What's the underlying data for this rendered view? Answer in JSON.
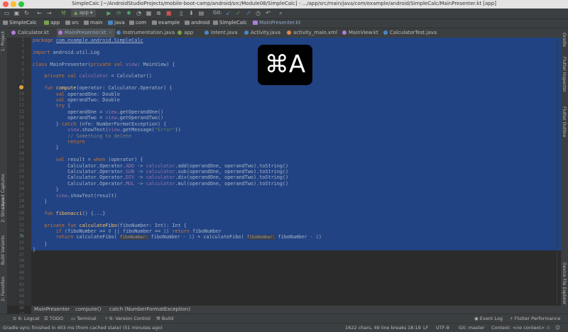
{
  "window": {
    "title": "SimpleCalc [~/AndroidStudioProjects/mobile-boot-camp/android/src/Module08/SimpleCalc] - .../app/src/main/java/com/example/android/SimpleCalc/MainPresenter.kt [app]"
  },
  "toolbar": {
    "run_config": "app",
    "git_label": "Git:"
  },
  "navbar": {
    "crumbs": [
      "SimpleCalc",
      "app",
      "src",
      "main",
      "java",
      "com",
      "example",
      "android",
      "SimpleCalc",
      "MainPresenter.kt"
    ]
  },
  "tabs": [
    {
      "label": "Calculator.kt",
      "active": false,
      "color": "#b07cd8"
    },
    {
      "label": "MainPresenter.kt",
      "active": true,
      "color": "#b07cd8"
    },
    {
      "label": "Instrumentation.java",
      "active": false,
      "color": "#4a86c8"
    },
    {
      "label": "app",
      "active": false,
      "color": "#7aa34a"
    },
    {
      "label": "Intent.java",
      "active": false,
      "color": "#4a86c8"
    },
    {
      "label": "Activity.java",
      "active": false,
      "color": "#4a86c8"
    },
    {
      "label": "activity_main.xml",
      "active": false,
      "color": "#e0884f"
    },
    {
      "label": "MainView.kt",
      "active": false,
      "color": "#b07cd8"
    },
    {
      "label": "CalculatorTest.java",
      "active": false,
      "color": "#4a86c8"
    }
  ],
  "left_tools": [
    "1: Project",
    "Layout Captures",
    "2: Structure",
    "Build Variants",
    "2: Favorites"
  ],
  "right_tools": [
    "Gradle",
    "Flutter Inspector",
    "Flutter Outline",
    "Device File Explorer"
  ],
  "gutter": {
    "line_numbers": [
      "1",
      "2",
      "3",
      "4",
      "5",
      "6",
      "7",
      "8",
      "9",
      "10",
      "11",
      "12",
      "13",
      "14",
      "15",
      "16",
      "17",
      "18",
      "19",
      "20",
      "21",
      "22",
      "23",
      "24",
      "25",
      "26",
      "27",
      "28",
      "29",
      "30",
      "31",
      "32",
      "33",
      "34",
      "35",
      "36",
      "37",
      "38",
      "39",
      "40",
      "41",
      "42",
      "43",
      "44",
      "45",
      "46",
      "47",
      "48",
      "49"
    ]
  },
  "code": {
    "package_kw": "package",
    "package_name": "com.example.android.SimpleCalc",
    "import_kw": "import",
    "import_name": "android.util.Log",
    "error_str": "\"Error\"",
    "comment": "// Something to delete",
    "hint_label": "fiboNumber:"
  },
  "breadcrumb": {
    "items": [
      "MainPresenter",
      "compute()",
      "catch (NumberFormatException)"
    ]
  },
  "tool_windows": [
    "6: Logcat",
    "TODO",
    "Terminal",
    "9: Version Control",
    "Build",
    "Event Log",
    "Flutter Performance"
  ],
  "status": {
    "message": "Gradle sync finished in 403 ms (from cached state) (51 minutes ago)",
    "chars": "1622 chars, 49 line breaks",
    "position": "18:19",
    "line_sep": "LF",
    "encoding": "UTF-8",
    "git": "Git: master",
    "context": "Context: <no context>"
  },
  "overlay": {
    "shortcut": "⌘A"
  }
}
